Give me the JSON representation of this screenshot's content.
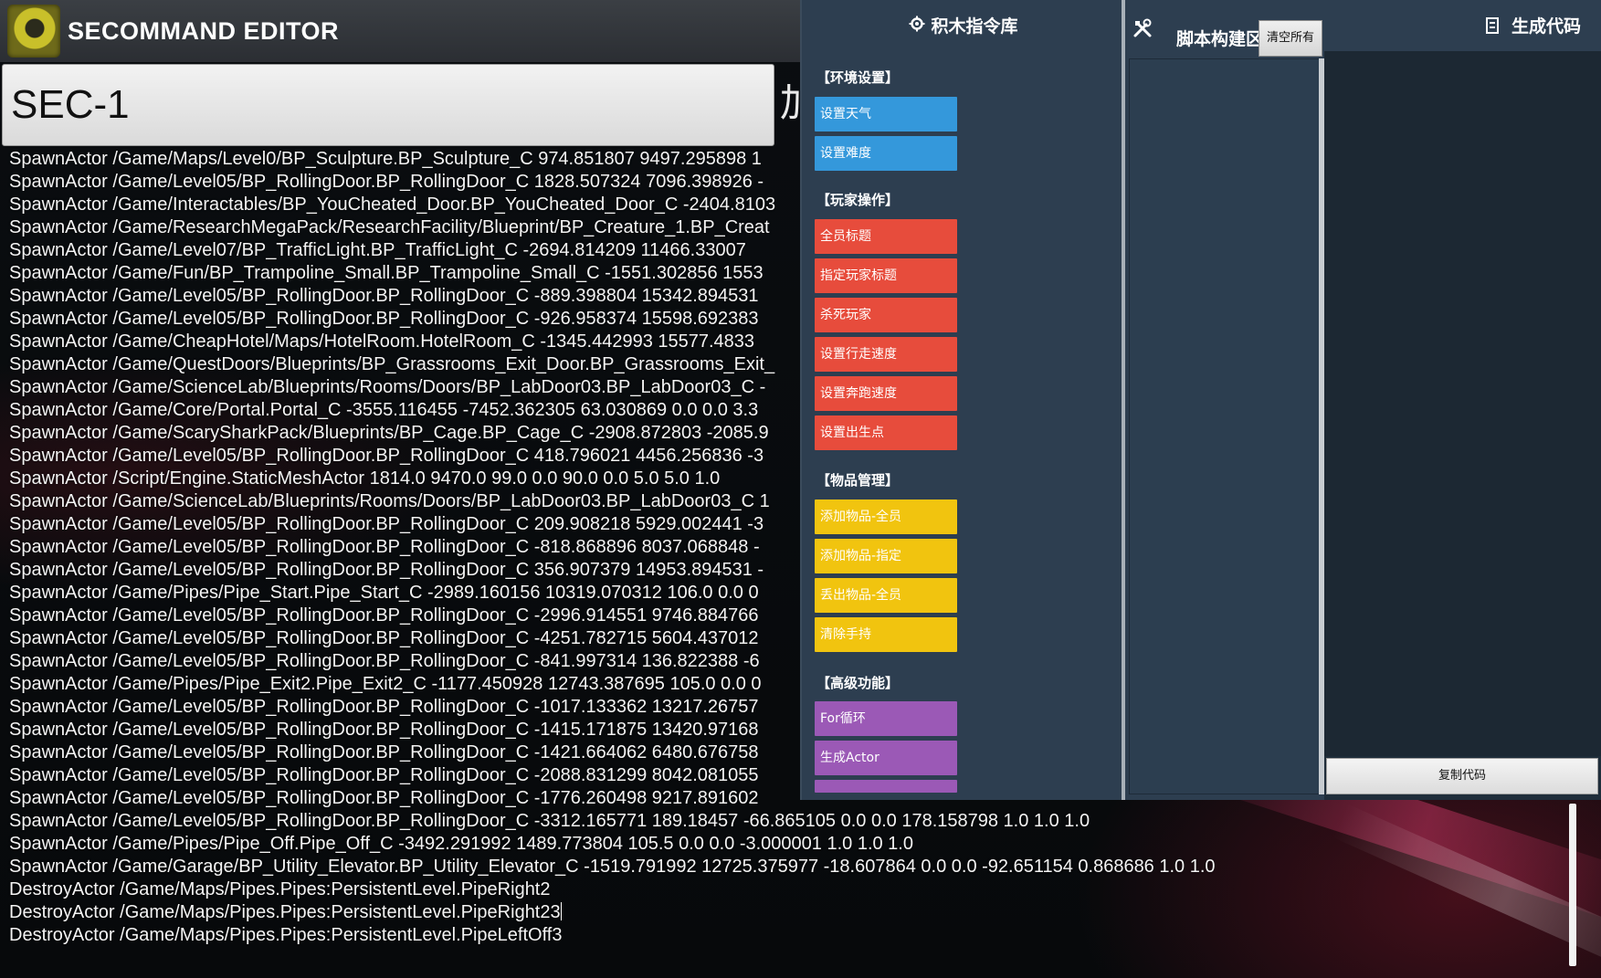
{
  "header": {
    "title": "SECOMMAND EDITOR"
  },
  "name_field": {
    "value": "SEC-1"
  },
  "add_glyph": "加",
  "command_lines": [
    "SpawnActor /Game/Maps/Level0/BP_Sculpture.BP_Sculpture_C 974.851807 9497.295898 1",
    "SpawnActor /Game/Level05/BP_RollingDoor.BP_RollingDoor_C 1828.507324 7096.398926 -",
    "SpawnActor /Game/Interactables/BP_YouCheated_Door.BP_YouCheated_Door_C -2404.8103",
    "SpawnActor /Game/ResearchMegaPack/ResearchFacility/Blueprint/BP_Creature_1.BP_Creat",
    "SpawnActor /Game/Level07/BP_TrafficLight.BP_TrafficLight_C -2694.814209 11466.33007",
    "SpawnActor /Game/Fun/BP_Trampoline_Small.BP_Trampoline_Small_C -1551.302856 1553",
    "SpawnActor /Game/Level05/BP_RollingDoor.BP_RollingDoor_C -889.398804 15342.894531",
    "SpawnActor /Game/Level05/BP_RollingDoor.BP_RollingDoor_C -926.958374 15598.692383",
    "SpawnActor /Game/CheapHotel/Maps/HotelRoom.HotelRoom_C -1345.442993 15577.4833",
    "SpawnActor /Game/QuestDoors/Blueprints/BP_Grassrooms_Exit_Door.BP_Grassrooms_Exit_",
    "SpawnActor /Game/ScienceLab/Blueprints/Rooms/Doors/BP_LabDoor03.BP_LabDoor03_C -",
    "SpawnActor /Game/Core/Portal.Portal_C -3555.116455 -7452.362305 63.030869 0.0 0.0 3.3",
    "SpawnActor /Game/ScarySharkPack/Blueprints/BP_Cage.BP_Cage_C -2908.872803 -2085.9",
    "SpawnActor /Game/Level05/BP_RollingDoor.BP_RollingDoor_C 418.796021 4456.256836 -3",
    "SpawnActor /Script/Engine.StaticMeshActor 1814.0 9470.0 99.0 0.0 90.0 0.0 5.0 5.0 1.0",
    "SpawnActor /Game/ScienceLab/Blueprints/Rooms/Doors/BP_LabDoor03.BP_LabDoor03_C 1",
    "SpawnActor /Game/Level05/BP_RollingDoor.BP_RollingDoor_C 209.908218 5929.002441 -3",
    "SpawnActor /Game/Level05/BP_RollingDoor.BP_RollingDoor_C -818.868896 8037.068848 -",
    "SpawnActor /Game/Level05/BP_RollingDoor.BP_RollingDoor_C 356.907379 14953.894531 -",
    "SpawnActor /Game/Pipes/Pipe_Start.Pipe_Start_C -2989.160156 10319.070312 106.0 0.0 0",
    "SpawnActor /Game/Level05/BP_RollingDoor.BP_RollingDoor_C -2996.914551 9746.884766",
    "SpawnActor /Game/Level05/BP_RollingDoor.BP_RollingDoor_C -4251.782715 5604.437012",
    "SpawnActor /Game/Level05/BP_RollingDoor.BP_RollingDoor_C -841.997314 136.822388 -6",
    "SpawnActor /Game/Pipes/Pipe_Exit2.Pipe_Exit2_C -1177.450928 12743.387695 105.0 0.0 0",
    "SpawnActor /Game/Level05/BP_RollingDoor.BP_RollingDoor_C -1017.133362 13217.26757",
    "SpawnActor /Game/Level05/BP_RollingDoor.BP_RollingDoor_C -1415.171875 13420.97168",
    "SpawnActor /Game/Level05/BP_RollingDoor.BP_RollingDoor_C -1421.664062 6480.676758",
    "SpawnActor /Game/Level05/BP_RollingDoor.BP_RollingDoor_C -2088.831299 8042.081055",
    "SpawnActor /Game/Level05/BP_RollingDoor.BP_RollingDoor_C -1776.260498 9217.891602",
    "SpawnActor /Game/Level05/BP_RollingDoor.BP_RollingDoor_C -3312.165771 189.18457 -66.865105 0.0 0.0 178.158798 1.0 1.0 1.0",
    "SpawnActor /Game/Pipes/Pipe_Off.Pipe_Off_C -3492.291992 1489.773804 105.5 0.0 0.0 -3.000001 1.0 1.0 1.0",
    "SpawnActor /Game/Garage/BP_Utility_Elevator.BP_Utility_Elevator_C -1519.791992 12725.375977 -18.607864 0.0 0.0 -92.651154 0.868686 1.0 1.0",
    "DestroyActor /Game/Maps/Pipes.Pipes:PersistentLevel.PipeRight2",
    "DestroyActor /Game/Maps/Pipes.Pipes:PersistentLevel.PipeRight23",
    "DestroyActor /Game/Maps/Pipes.Pipes:PersistentLevel.PipeLeftOff3"
  ],
  "library": {
    "title": "积木指令库",
    "icon": "gear-icon",
    "categories": [
      {
        "label": "【环境设置】",
        "color": "#3498db",
        "blocks": [
          "设置天气",
          "设置难度"
        ]
      },
      {
        "label": "【玩家操作】",
        "color": "#e74c3c",
        "blocks": [
          "全员标题",
          "指定玩家标题",
          "杀死玩家",
          "设置行走速度",
          "设置奔跑速度",
          "设置出生点"
        ]
      },
      {
        "label": "【物品管理】",
        "color": "#f1c40f",
        "blocks": [
          "添加物品-全员",
          "添加物品-指定",
          "丢出物品-全员",
          "清除手持"
        ]
      },
      {
        "label": "【高级功能】",
        "color": "#9b59b6",
        "blocks": [
          "For循环",
          "生成Actor"
        ]
      }
    ]
  },
  "build": {
    "title": "脚本构建区",
    "icon": "tools-icon",
    "clear_label": "清空所有"
  },
  "code": {
    "title": "生成代码",
    "icon": "document-icon",
    "copy_label": "复制代码"
  }
}
